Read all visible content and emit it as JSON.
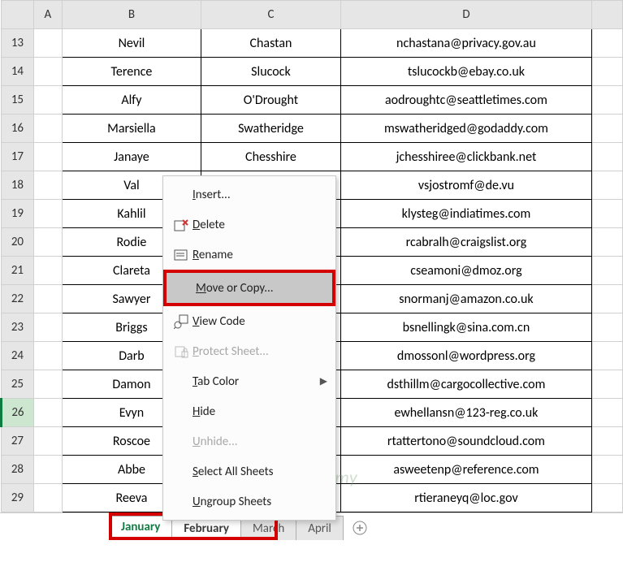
{
  "columns": {
    "a": "A",
    "b": "B",
    "c": "C",
    "d": "D"
  },
  "rows": [
    {
      "n": "13",
      "b": "Nevil",
      "c": "Chastan",
      "d": "nchastana@privacy.gov.au"
    },
    {
      "n": "14",
      "b": "Terence",
      "c": "Slucock",
      "d": "tslucockb@ebay.co.uk"
    },
    {
      "n": "15",
      "b": "Alfy",
      "c": "O'Drought",
      "d": "aodroughtc@seattletimes.com"
    },
    {
      "n": "16",
      "b": "Marsiella",
      "c": "Swatheridge",
      "d": "mswatheridged@godaddy.com"
    },
    {
      "n": "17",
      "b": "Janaye",
      "c": "Chesshire",
      "d": "jchesshiree@clickbank.net"
    },
    {
      "n": "18",
      "b": "Val",
      "c": "",
      "d": "vsjostromf@de.vu"
    },
    {
      "n": "19",
      "b": "Kahlil",
      "c": "",
      "d": "klysteg@indiatimes.com"
    },
    {
      "n": "20",
      "b": "Rodie",
      "c": "",
      "d": "rcabralh@craigslist.org"
    },
    {
      "n": "21",
      "b": "Clareta",
      "c": "",
      "d": "cseamoni@dmoz.org"
    },
    {
      "n": "22",
      "b": "Sawyer",
      "c": "",
      "d": "snormanj@amazon.co.uk"
    },
    {
      "n": "23",
      "b": "Briggs",
      "c": "",
      "d": "bsnellingk@sina.com.cn"
    },
    {
      "n": "24",
      "b": "Darb",
      "c": "",
      "d": "dmossonl@wordpress.org"
    },
    {
      "n": "25",
      "b": "Damon",
      "c": "",
      "d": "dsthillm@cargocollective.com"
    },
    {
      "n": "26",
      "b": "Evyn",
      "c": "",
      "d": "ewhellansn@123-reg.co.uk"
    },
    {
      "n": "27",
      "b": "Roscoe",
      "c": "",
      "d": "rtattertono@soundcloud.com"
    },
    {
      "n": "28",
      "b": "Abbe",
      "c": "",
      "d": "asweetenp@reference.com"
    },
    {
      "n": "29",
      "b": "Reeva",
      "c": "",
      "d": "rtieraneyq@loc.gov"
    }
  ],
  "active_row": "26",
  "context_menu": {
    "insert": "Insert...",
    "delete": "Delete",
    "rename": "Rename",
    "move_copy": "Move or Copy...",
    "view_code": "View Code",
    "protect": "Protect Sheet...",
    "tab_color": "Tab Color",
    "hide": "Hide",
    "unhide": "Unhide...",
    "select_all": "Select All Sheets",
    "ungroup": "Ungroup Sheets"
  },
  "mnemonics": {
    "insert": "I",
    "delete": "D",
    "rename": "R",
    "move_copy": "M",
    "view_code": "V",
    "protect": "P",
    "tab_color": "T",
    "hide": "H",
    "unhide": "U",
    "select_all": "S",
    "ungroup": "U"
  },
  "tabs": {
    "t1": "January",
    "t2": "February",
    "t3": "March",
    "t4": "April"
  },
  "watermark": "exceldemy"
}
